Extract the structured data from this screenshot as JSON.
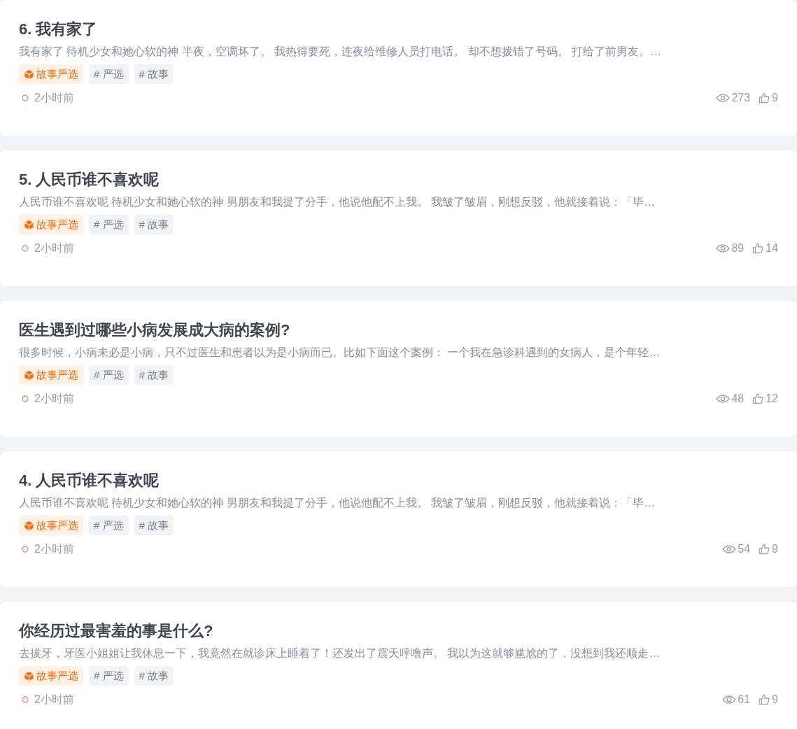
{
  "posts": [
    {
      "title": "6. 我有家了",
      "excerpt": "我有家了 待机少女和她心软的神 半夜，空调坏了。 我热得要死，连夜给维修人员打电话。 却不想拨错了号码。 打给了前男友。…",
      "tags": [
        {
          "kind": "featured",
          "label": "故事严选"
        },
        {
          "kind": "topic",
          "label": "# 严选"
        },
        {
          "kind": "topic",
          "label": "# 故事"
        }
      ],
      "time": "2小时前",
      "views": "273",
      "likes": "9"
    },
    {
      "title": "5. 人民币谁不喜欢呢",
      "excerpt": "人民币谁不喜欢呢 待机少女和她心软的神 男朋友和我提了分手，他说他配不上我。 我皱了皱眉，刚想反驳，他就接着说：「毕…",
      "tags": [
        {
          "kind": "featured",
          "label": "故事严选"
        },
        {
          "kind": "topic",
          "label": "# 严选"
        },
        {
          "kind": "topic",
          "label": "# 故事"
        }
      ],
      "time": "2小时前",
      "views": "89",
      "likes": "14"
    },
    {
      "title": "医生遇到过哪些小病发展成大病的案例?",
      "excerpt": "很多时候，小病未必是小病，只不过医生和患者以为是小病而已。比如下面这个案例： 一个我在急诊科遇到的女病人，是个年轻…",
      "tags": [
        {
          "kind": "featured",
          "label": "故事严选"
        },
        {
          "kind": "topic",
          "label": "# 严选"
        },
        {
          "kind": "topic",
          "label": "# 故事"
        }
      ],
      "time": "2小时前",
      "views": "48",
      "likes": "12"
    },
    {
      "title": "4. 人民币谁不喜欢呢",
      "excerpt": "人民币谁不喜欢呢 待机少女和她心软的神 男朋友和我提了分手，他说他配不上我。 我皱了皱眉，刚想反驳，他就接着说：「毕…",
      "tags": [
        {
          "kind": "featured",
          "label": "故事严选"
        },
        {
          "kind": "topic",
          "label": "# 严选"
        },
        {
          "kind": "topic",
          "label": "# 故事"
        }
      ],
      "time": "2小时前",
      "views": "54",
      "likes": "9"
    },
    {
      "title": "你经历过最害羞的事是什么?",
      "excerpt": "去拔牙，牙医小姐姐让我休息一下，我竟然在就诊床上睡着了！还发出了震天呼噜声。 我以为这就够尴尬的了，没想到我还顺走…",
      "tags": [
        {
          "kind": "featured",
          "label": "故事严选"
        },
        {
          "kind": "topic",
          "label": "# 严选"
        },
        {
          "kind": "topic",
          "label": "# 故事"
        }
      ],
      "time": "2小时前",
      "views": "61",
      "likes": "9"
    }
  ]
}
